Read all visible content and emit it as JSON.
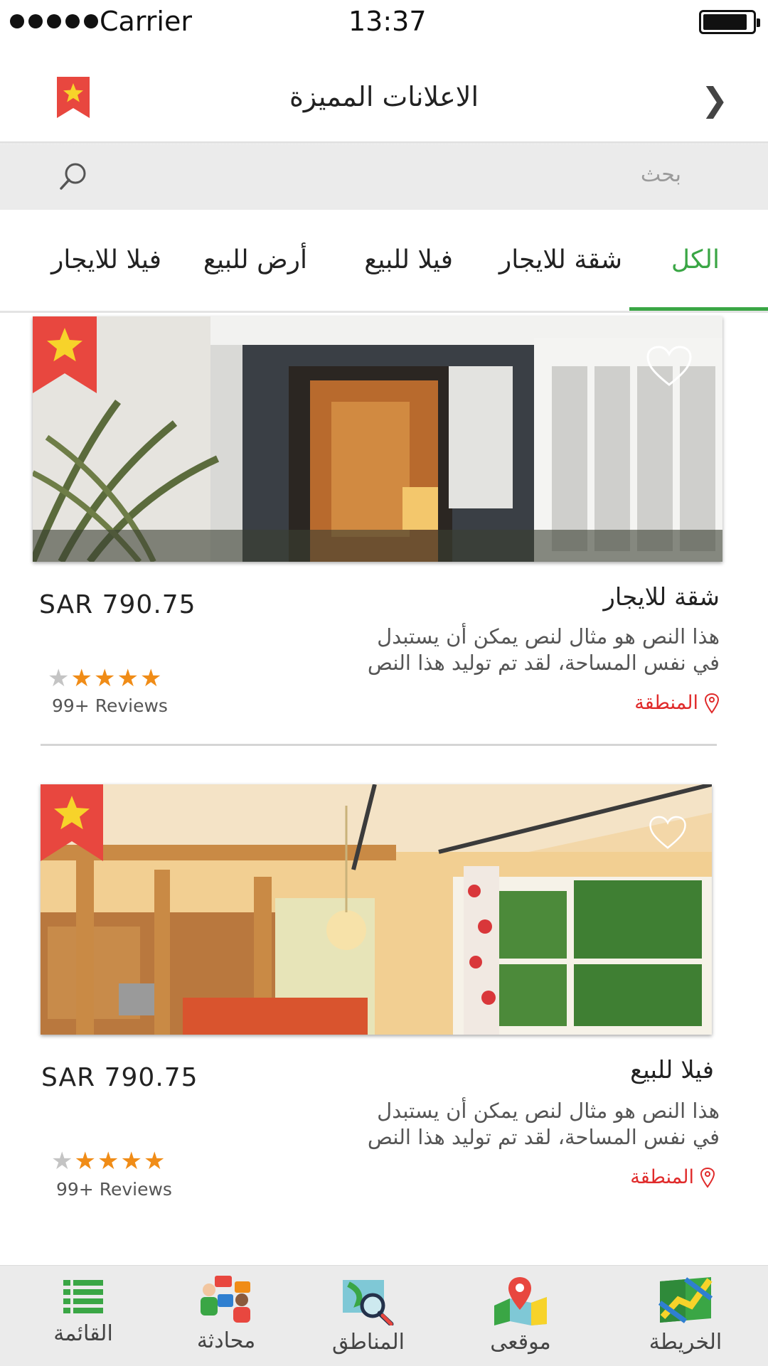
{
  "status_bar": {
    "carrier": "Carrier",
    "time": "13:37"
  },
  "header": {
    "title": "الاعلانات المميزة",
    "back_icon": "chevron-back-icon",
    "featured_icon": "star-ribbon-icon"
  },
  "search": {
    "placeholder": "بحث",
    "icon": "search-icon"
  },
  "tabs": [
    {
      "label": "الكل",
      "active": true
    },
    {
      "label": "شقة للايجار",
      "active": false
    },
    {
      "label": "فيلا للبيع",
      "active": false
    },
    {
      "label": "أرض للبيع",
      "active": false
    },
    {
      "label": "فيلا للايجار",
      "active": false
    }
  ],
  "listings": [
    {
      "title": "شقة للايجار",
      "price": "SAR  790.75",
      "desc_line1": "هذا النص هو مثال لنص يمكن أن يستبدل",
      "desc_line2": "في نفس المساحة، لقد تم توليد هذا النص",
      "area": "المنطقة",
      "rating": 4,
      "max_rating": 5,
      "reviews": "99+ Reviews"
    },
    {
      "title": "فيلا للبيع",
      "price": "SAR  790.75",
      "desc_line1": "هذا النص هو مثال لنص يمكن أن يستبدل",
      "desc_line2": "في نفس المساحة، لقد تم توليد هذا النص",
      "area": "المنطقة",
      "rating": 4,
      "max_rating": 5,
      "reviews": "99+ Reviews"
    }
  ],
  "bottom_nav": [
    {
      "label": "القائمة",
      "icon": "list-icon"
    },
    {
      "label": "محادثة",
      "icon": "chat-icon"
    },
    {
      "label": "المناطق",
      "icon": "areas-map-search-icon"
    },
    {
      "label": "موقعى",
      "icon": "my-location-icon"
    },
    {
      "label": "الخريطة",
      "icon": "map-icon"
    }
  ],
  "colors": {
    "accent": "#3aa645",
    "ribbon": "#e8473f",
    "star": "#f08c17",
    "area_text": "#e02b2b"
  }
}
